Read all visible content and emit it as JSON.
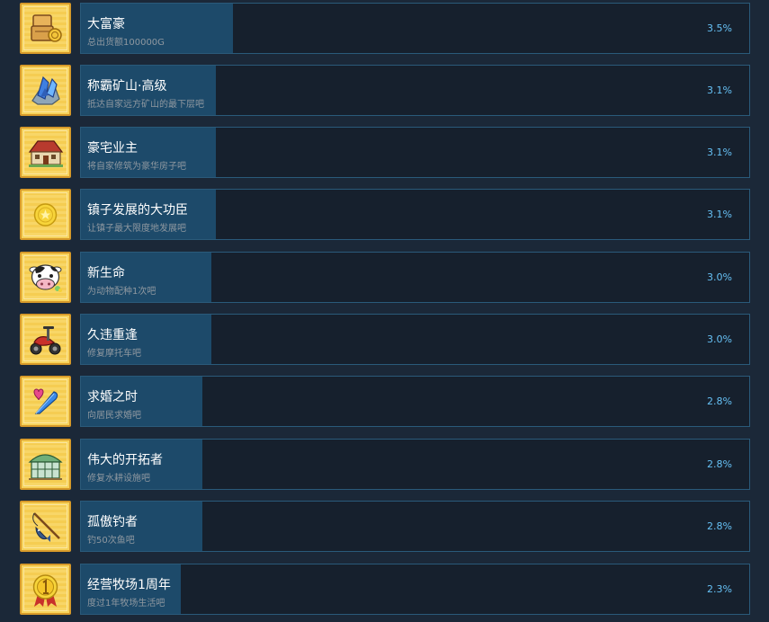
{
  "achievements": [
    {
      "title": "大富豪",
      "description": "总出货额100000G",
      "percent": "3.5%",
      "icon": "money-chest-icon",
      "progress": 0.035
    },
    {
      "title": "称霸矿山·高级",
      "description": "抵达自家远方矿山的最下层吧",
      "percent": "3.1%",
      "icon": "crystal-ore-icon",
      "progress": 0.031
    },
    {
      "title": "豪宅业主",
      "description": "将自家修筑为豪华房子吧",
      "percent": "3.1%",
      "icon": "mansion-icon",
      "progress": 0.031
    },
    {
      "title": "镇子发展的大功臣",
      "description": "让镇子最大限度地发展吧",
      "percent": "3.1%",
      "icon": "gold-coin-icon",
      "progress": 0.031
    },
    {
      "title": "新生命",
      "description": "为动物配种1次吧",
      "percent": "3.0%",
      "icon": "cow-icon",
      "progress": 0.03
    },
    {
      "title": "久违重逢",
      "description": "修复摩托车吧",
      "percent": "3.0%",
      "icon": "motorcycle-icon",
      "progress": 0.03
    },
    {
      "title": "求婚之时",
      "description": "向居民求婚吧",
      "percent": "2.8%",
      "icon": "blue-feather-icon",
      "progress": 0.028
    },
    {
      "title": "伟大的开拓者",
      "description": "修复水耕设施吧",
      "percent": "2.8%",
      "icon": "greenhouse-icon",
      "progress": 0.028
    },
    {
      "title": "孤傲钓者",
      "description": "钓50次鱼吧",
      "percent": "2.8%",
      "icon": "fishing-rod-icon",
      "progress": 0.028
    },
    {
      "title": "经营牧场1周年",
      "description": "度过1年牧场生活吧",
      "percent": "2.3%",
      "icon": "medal-icon",
      "progress": 0.023
    }
  ]
}
